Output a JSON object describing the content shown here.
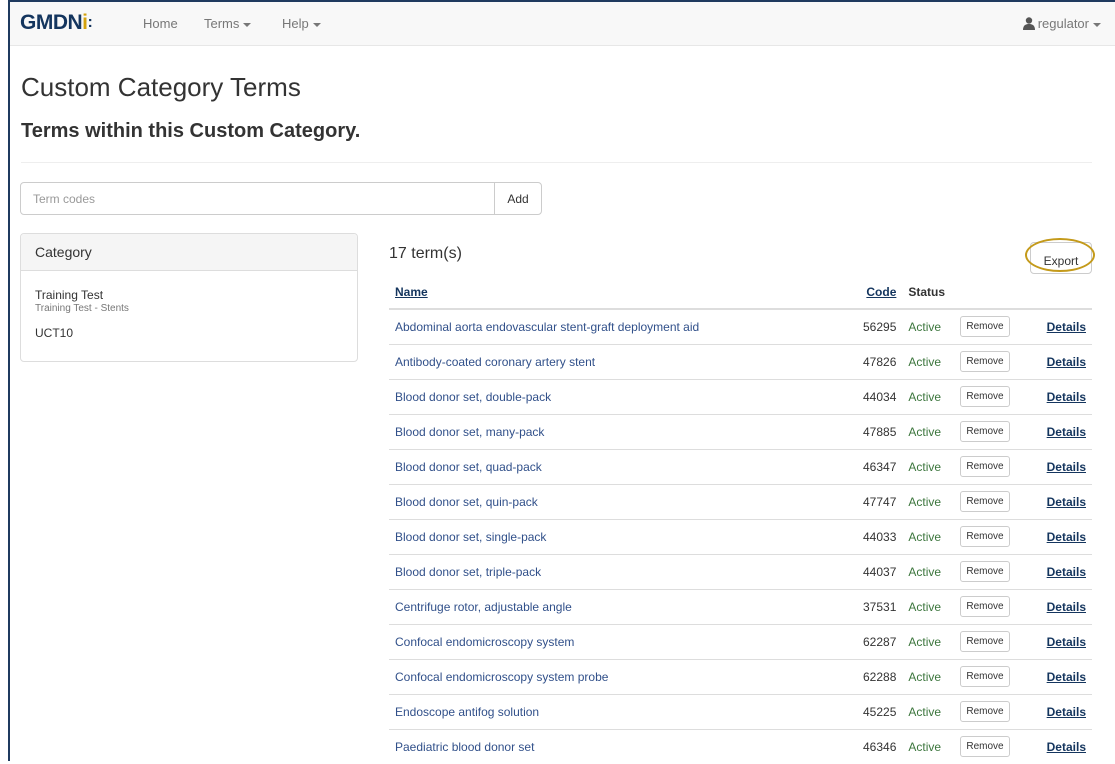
{
  "navbar": {
    "brand_main": "GMDN",
    "brand_accent": "i",
    "brand_dots": ":",
    "links": [
      {
        "label": "Home"
      },
      {
        "label": "Terms"
      },
      {
        "label": "Help"
      }
    ],
    "user": "regulator"
  },
  "page": {
    "title": "Custom Category Terms",
    "subtitle": "Terms within this Custom Category."
  },
  "search": {
    "placeholder": "Term codes",
    "add_label": "Add"
  },
  "category_panel": {
    "heading": "Category",
    "name": "Training Test",
    "sub": "Training Test - Stents",
    "code": "UCT10"
  },
  "results": {
    "count_label": "17 term(s)",
    "export_label": "Export",
    "columns": {
      "name": "Name",
      "code": "Code",
      "status": "Status"
    },
    "rows": [
      {
        "name": "Abdominal aorta endovascular stent-graft deployment aid",
        "code": "56295",
        "status": "Active",
        "remove": "Remove",
        "details": "Details"
      },
      {
        "name": "Antibody-coated coronary artery stent",
        "code": "47826",
        "status": "Active",
        "remove": "Remove",
        "details": "Details"
      },
      {
        "name": "Blood donor set, double-pack",
        "code": "44034",
        "status": "Active",
        "remove": "Remove",
        "details": "Details"
      },
      {
        "name": "Blood donor set, many-pack",
        "code": "47885",
        "status": "Active",
        "remove": "Remove",
        "details": "Details"
      },
      {
        "name": "Blood donor set, quad-pack",
        "code": "46347",
        "status": "Active",
        "remove": "Remove",
        "details": "Details"
      },
      {
        "name": "Blood donor set, quin-pack",
        "code": "47747",
        "status": "Active",
        "remove": "Remove",
        "details": "Details"
      },
      {
        "name": "Blood donor set, single-pack",
        "code": "44033",
        "status": "Active",
        "remove": "Remove",
        "details": "Details"
      },
      {
        "name": "Blood donor set, triple-pack",
        "code": "44037",
        "status": "Active",
        "remove": "Remove",
        "details": "Details"
      },
      {
        "name": "Centrifuge rotor, adjustable angle",
        "code": "37531",
        "status": "Active",
        "remove": "Remove",
        "details": "Details"
      },
      {
        "name": "Confocal endomicroscopy system",
        "code": "62287",
        "status": "Active",
        "remove": "Remove",
        "details": "Details"
      },
      {
        "name": "Confocal endomicroscopy system probe",
        "code": "62288",
        "status": "Active",
        "remove": "Remove",
        "details": "Details"
      },
      {
        "name": "Endoscope antifog solution",
        "code": "45225",
        "status": "Active",
        "remove": "Remove",
        "details": "Details"
      },
      {
        "name": "Paediatric blood donor set",
        "code": "46346",
        "status": "Active",
        "remove": "Remove",
        "details": "Details"
      }
    ]
  },
  "colors": {
    "brand_navy": "#14355e",
    "brand_gold": "#d4a20d",
    "status_active": "#3c763d",
    "highlight": "#c49a1a"
  }
}
